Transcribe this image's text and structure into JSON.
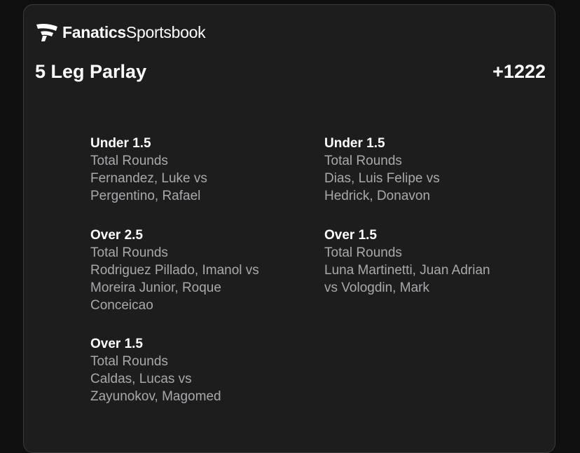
{
  "brand": {
    "name_bold": "Fanatics",
    "name_regular": "Sportsbook",
    "logo_icon": "fanatics-flag-icon"
  },
  "bet": {
    "title": "5 Leg Parlay",
    "odds": "+1222"
  },
  "legs": [
    {
      "selection": "Under 1.5",
      "market": "Total Rounds",
      "event_line1": "Fernandez, Luke vs",
      "event_line2": "Pergentino, Rafael",
      "event_line3": ""
    },
    {
      "selection": "Under 1.5",
      "market": "Total Rounds",
      "event_line1": "Dias, Luis Felipe vs",
      "event_line2": "Hedrick, Donavon",
      "event_line3": ""
    },
    {
      "selection": "Over 2.5",
      "market": "Total Rounds",
      "event_line1": "Rodriguez Pillado, Imanol vs",
      "event_line2": "Moreira Junior, Roque",
      "event_line3": "Conceicao"
    },
    {
      "selection": "Over 1.5",
      "market": "Total Rounds",
      "event_line1": "Luna Martinetti, Juan Adrian",
      "event_line2": "vs Vologdin, Mark",
      "event_line3": ""
    },
    {
      "selection": "Over 1.5",
      "market": "Total Rounds",
      "event_line1": "Caldas, Lucas vs",
      "event_line2": "Zayunokov, Magomed",
      "event_line3": ""
    }
  ],
  "colors": {
    "background": "#0f0f10",
    "card": "#1d1d1e",
    "text_primary": "#ffffff",
    "text_secondary": "#a9a9ad"
  }
}
